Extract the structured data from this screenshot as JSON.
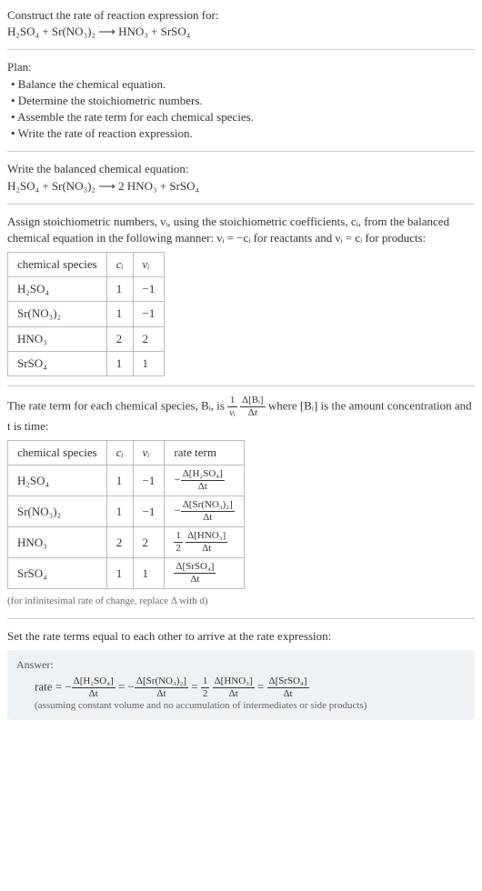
{
  "head": {
    "title": "Construct the rate of reaction expression for:",
    "eq": "H₂SO₄ + Sr(NO₃)₂  ⟶  HNO₃ + SrSO₄"
  },
  "plan": {
    "label": "Plan:",
    "items": [
      "• Balance the chemical equation.",
      "• Determine the stoichiometric numbers.",
      "• Assemble the rate term for each chemical species.",
      "• Write the rate of reaction expression."
    ]
  },
  "balanced": {
    "label": "Write the balanced chemical equation:",
    "eq": "H₂SO₄ + Sr(NO₃)₂  ⟶  2 HNO₃ + SrSO₄"
  },
  "stoich": {
    "text1": "Assign stoichiometric numbers, νᵢ, using the stoichiometric coefficients, cᵢ, from the balanced chemical equation in the following manner: νᵢ = −cᵢ for reactants and νᵢ = cᵢ for products:",
    "headers": [
      "chemical species",
      "cᵢ",
      "νᵢ"
    ],
    "rows": [
      {
        "sp": "H₂SO₄",
        "c": "1",
        "v": "−1"
      },
      {
        "sp": "Sr(NO₃)₂",
        "c": "1",
        "v": "−1"
      },
      {
        "sp": "HNO₃",
        "c": "2",
        "v": "2"
      },
      {
        "sp": "SrSO₄",
        "c": "1",
        "v": "1"
      }
    ]
  },
  "rateterm": {
    "pre": "The rate term for each chemical species, Bᵢ, is ",
    "mid": " where [Bᵢ] is the amount concentration and t is time:",
    "headers": [
      "chemical species",
      "cᵢ",
      "νᵢ",
      "rate term"
    ],
    "rows": [
      {
        "sp": "H₂SO₄",
        "c": "1",
        "v": "−1",
        "num": "Δ[H₂SO₄]",
        "den": "Δt",
        "neg": "−",
        "half": ""
      },
      {
        "sp": "Sr(NO₃)₂",
        "c": "1",
        "v": "−1",
        "num": "Δ[Sr(NO₃)₂]",
        "den": "Δt",
        "neg": "−",
        "half": ""
      },
      {
        "sp": "HNO₃",
        "c": "2",
        "v": "2",
        "num": "Δ[HNO₃]",
        "den": "Δt",
        "neg": "",
        "half": "½ "
      },
      {
        "sp": "SrSO₄",
        "c": "1",
        "v": "1",
        "num": "Δ[SrSO₄]",
        "den": "Δt",
        "neg": "",
        "half": ""
      }
    ],
    "note": "(for infinitesimal rate of change, replace Δ with d)"
  },
  "set": "Set the rate terms equal to each other to arrive at the rate expression:",
  "answer": {
    "label": "Answer:",
    "prefix": "rate = ",
    "terms": [
      {
        "neg": "−",
        "half": "",
        "num": "Δ[H₂SO₄]",
        "den": "Δt"
      },
      {
        "neg": "−",
        "half": "",
        "num": "Δ[Sr(NO₃)₂]",
        "den": "Δt"
      },
      {
        "neg": "",
        "half": "½ ",
        "num": "Δ[HNO₃]",
        "den": "Δt"
      },
      {
        "neg": "",
        "half": "",
        "num": "Δ[SrSO₄]",
        "den": "Δt"
      }
    ],
    "note": "(assuming constant volume and no accumulation of intermediates or side products)"
  },
  "chart_data": {
    "type": "table",
    "tables": [
      {
        "title": "stoichiometric numbers",
        "columns": [
          "chemical species",
          "c_i",
          "v_i"
        ],
        "rows": [
          [
            "H2SO4",
            1,
            -1
          ],
          [
            "Sr(NO3)2",
            1,
            -1
          ],
          [
            "HNO3",
            2,
            2
          ],
          [
            "SrSO4",
            1,
            1
          ]
        ]
      },
      {
        "title": "rate terms",
        "columns": [
          "chemical species",
          "c_i",
          "v_i",
          "rate term"
        ],
        "rows": [
          [
            "H2SO4",
            1,
            -1,
            "-Δ[H2SO4]/Δt"
          ],
          [
            "Sr(NO3)2",
            1,
            -1,
            "-Δ[Sr(NO3)2]/Δt"
          ],
          [
            "HNO3",
            2,
            2,
            "(1/2)Δ[HNO3]/Δt"
          ],
          [
            "SrSO4",
            1,
            1,
            "Δ[SrSO4]/Δt"
          ]
        ]
      }
    ]
  }
}
